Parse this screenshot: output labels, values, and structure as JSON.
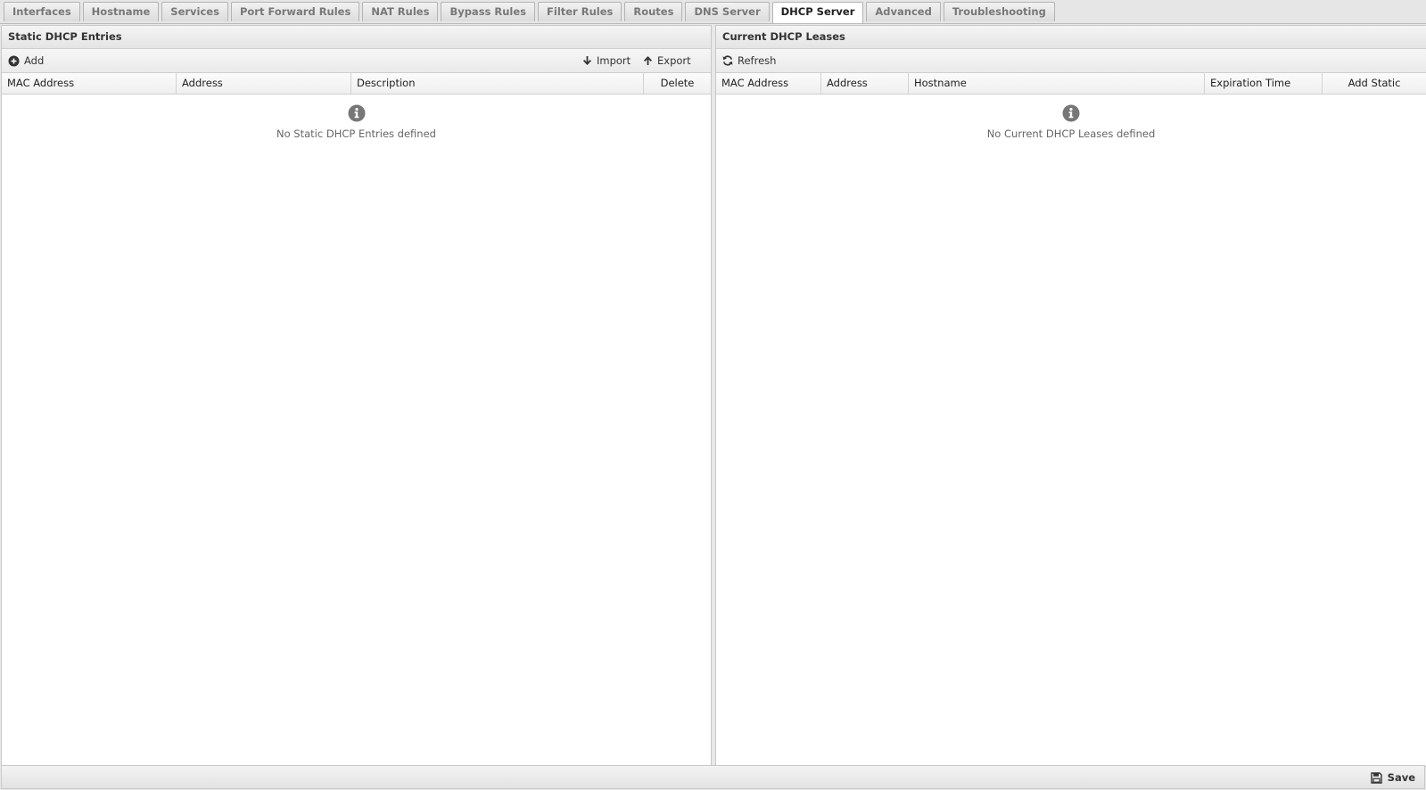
{
  "tabs": [
    {
      "label": "Interfaces",
      "active": false
    },
    {
      "label": "Hostname",
      "active": false
    },
    {
      "label": "Services",
      "active": false
    },
    {
      "label": "Port Forward Rules",
      "active": false
    },
    {
      "label": "NAT Rules",
      "active": false
    },
    {
      "label": "Bypass Rules",
      "active": false
    },
    {
      "label": "Filter Rules",
      "active": false
    },
    {
      "label": "Routes",
      "active": false
    },
    {
      "label": "DNS Server",
      "active": false
    },
    {
      "label": "DHCP Server",
      "active": true
    },
    {
      "label": "Advanced",
      "active": false
    },
    {
      "label": "Troubleshooting",
      "active": false
    }
  ],
  "static_entries": {
    "title": "Static DHCP Entries",
    "add_label": "Add",
    "import_label": "Import",
    "export_label": "Export",
    "columns": [
      "MAC Address",
      "Address",
      "Description",
      "Delete"
    ],
    "empty_text": "No Static DHCP Entries defined"
  },
  "current_leases": {
    "title": "Current DHCP Leases",
    "refresh_label": "Refresh",
    "columns": [
      "MAC Address",
      "Address",
      "Hostname",
      "Expiration Time",
      "Add Static"
    ],
    "empty_text": "No Current DHCP Leases defined"
  },
  "footer": {
    "save_label": "Save"
  },
  "colors": {
    "icon": "#555555",
    "info_icon": "#777777"
  }
}
